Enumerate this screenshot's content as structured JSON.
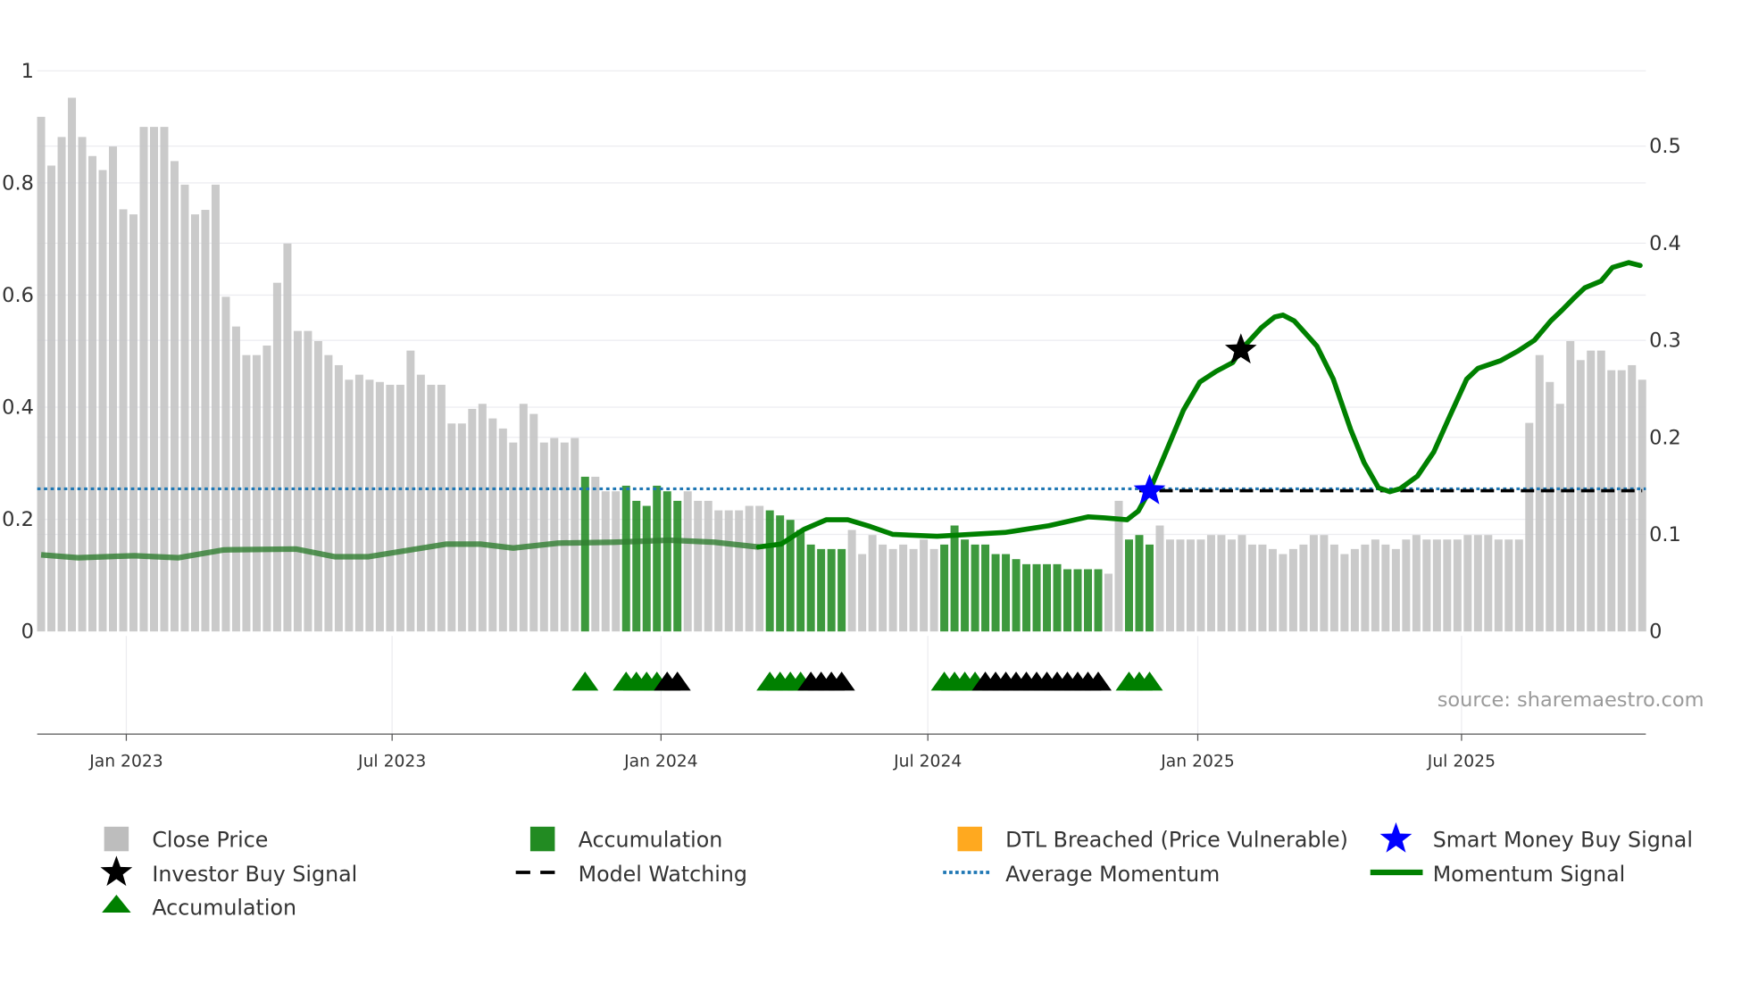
{
  "chart_data": {
    "type": "bar",
    "title": "",
    "xlabel": "",
    "ylabel_left": "",
    "ylabel_right": "",
    "frequency": "weekly",
    "left_axis": {
      "range": [
        0,
        1
      ],
      "ticks": [
        "0",
        "0.2",
        "0.4",
        "0.6",
        "0.8",
        "1"
      ],
      "tick_values": [
        0,
        0.2,
        0.4,
        0.6,
        0.8,
        1
      ]
    },
    "right_axis": {
      "range": [
        0,
        0.5
      ],
      "ticks": [
        "0",
        "0.1",
        "0.2",
        "0.3",
        "0.4",
        "0.5"
      ],
      "tick_values": [
        0,
        0.1,
        0.2,
        0.3,
        0.4,
        0.5
      ]
    },
    "x_ticks": [
      {
        "label": "Jan 2023",
        "week_index": 8.3
      },
      {
        "label": "Jul 2023",
        "week_index": 34.2
      },
      {
        "label": "Jan 2024",
        "week_index": 60.4
      },
      {
        "label": "Jul 2024",
        "week_index": 86.4
      },
      {
        "label": "Jan 2025",
        "week_index": 112.7
      },
      {
        "label": "Jul 2025",
        "week_index": 138.4
      }
    ],
    "close_price": [
      0.918,
      0.831,
      0.882,
      0.952,
      0.882,
      0.848,
      0.823,
      0.865,
      0.753,
      0.744,
      0.9,
      0.9,
      0.9,
      0.839,
      0.797,
      0.744,
      0.752,
      0.797,
      0.597,
      0.544,
      0.493,
      0.493,
      0.51,
      0.622,
      0.692,
      0.536,
      0.536,
      0.518,
      0.493,
      0.475,
      0.449,
      0.458,
      0.449,
      0.445,
      0.44,
      0.44,
      0.501,
      0.458,
      0.44,
      0.44,
      0.371,
      0.371,
      0.397,
      0.406,
      0.38,
      0.362,
      0.337,
      0.406,
      0.388,
      0.337,
      0.345,
      0.337,
      0.345,
      0.276,
      0.276,
      0.25,
      0.25,
      0.26,
      0.233,
      0.224,
      0.26,
      0.25,
      0.233,
      0.25,
      0.233,
      0.233,
      0.216,
      0.216,
      0.216,
      0.224,
      0.224,
      0.216,
      0.207,
      0.199,
      0.181,
      0.155,
      0.147,
      0.147,
      0.147,
      0.181,
      0.138,
      0.172,
      0.155,
      0.147,
      0.155,
      0.147,
      0.164,
      0.147,
      0.155,
      0.189,
      0.164,
      0.155,
      0.155,
      0.138,
      0.138,
      0.129,
      0.12,
      0.12,
      0.12,
      0.12,
      0.111,
      0.111,
      0.111,
      0.111,
      0.103,
      0.233,
      0.164,
      0.172,
      0.155,
      0.189,
      0.164,
      0.164,
      0.164,
      0.164,
      0.172,
      0.172,
      0.164,
      0.172,
      0.155,
      0.155,
      0.147,
      0.138,
      0.147,
      0.155,
      0.172,
      0.172,
      0.155,
      0.138,
      0.147,
      0.155,
      0.164,
      0.155,
      0.147,
      0.164,
      0.172,
      0.164,
      0.164,
      0.164,
      0.164,
      0.172,
      0.172,
      0.172,
      0.164,
      0.164,
      0.164,
      0.372,
      0.493,
      0.445,
      0.406,
      0.518,
      0.484,
      0.501,
      0.501,
      0.466,
      0.466,
      0.475,
      0.449
    ],
    "accumulation_bar_indices": [
      53,
      57,
      58,
      59,
      60,
      61,
      62,
      71,
      72,
      73,
      74,
      75,
      76,
      77,
      78,
      88,
      89,
      90,
      91,
      92,
      93,
      94,
      95,
      96,
      97,
      98,
      99,
      100,
      101,
      102,
      103,
      106,
      107,
      108
    ],
    "momentum_signal": [
      [
        0,
        0.079
      ],
      [
        3.6,
        0.076
      ],
      [
        9.1,
        0.078
      ],
      [
        13.4,
        0.076
      ],
      [
        17.8,
        0.084
      ],
      [
        24.8,
        0.085
      ],
      [
        28.6,
        0.077
      ],
      [
        31.9,
        0.077
      ],
      [
        39.5,
        0.09
      ],
      [
        42.8,
        0.09
      ],
      [
        46,
        0.086
      ],
      [
        50.4,
        0.091
      ],
      [
        55.8,
        0.092
      ],
      [
        61.2,
        0.094
      ],
      [
        65.6,
        0.092
      ],
      [
        69.9,
        0.087
      ],
      [
        72.1,
        0.09
      ],
      [
        74.3,
        0.105
      ],
      [
        76.5,
        0.115
      ],
      [
        78.6,
        0.115
      ],
      [
        80.8,
        0.108
      ],
      [
        83,
        0.1
      ],
      [
        87.3,
        0.098
      ],
      [
        93.9,
        0.102
      ],
      [
        98.2,
        0.109
      ],
      [
        102,
        0.118
      ],
      [
        103.6,
        0.117
      ],
      [
        105.8,
        0.115
      ],
      [
        106.9,
        0.124
      ],
      [
        108,
        0.145
      ],
      [
        109.6,
        0.185
      ],
      [
        111.3,
        0.228
      ],
      [
        112.9,
        0.257
      ],
      [
        114.5,
        0.268
      ],
      [
        116.1,
        0.277
      ],
      [
        116.9,
        0.29
      ],
      [
        118.9,
        0.313
      ],
      [
        120.2,
        0.324
      ],
      [
        121,
        0.326
      ],
      [
        122.1,
        0.32
      ],
      [
        124.3,
        0.294
      ],
      [
        125.9,
        0.26
      ],
      [
        127.6,
        0.208
      ],
      [
        128.9,
        0.174
      ],
      [
        130.3,
        0.148
      ],
      [
        131.4,
        0.144
      ],
      [
        132.4,
        0.147
      ],
      [
        134.1,
        0.16
      ],
      [
        135.7,
        0.185
      ],
      [
        137.3,
        0.223
      ],
      [
        138.9,
        0.26
      ],
      [
        140,
        0.271
      ],
      [
        142.2,
        0.279
      ],
      [
        143.9,
        0.289
      ],
      [
        145.5,
        0.3
      ],
      [
        147.1,
        0.32
      ],
      [
        148.2,
        0.331
      ],
      [
        149.3,
        0.343
      ],
      [
        150.4,
        0.354
      ],
      [
        152,
        0.361
      ],
      [
        153.1,
        0.375
      ],
      [
        154.7,
        0.38
      ],
      [
        155.8,
        0.377
      ]
    ],
    "momentum_muted_until_index": 72,
    "average_momentum": 0.147,
    "model_watching": {
      "value": 0.145,
      "from_index": 107,
      "to_index": 156
    },
    "smart_money_buy_signal": {
      "index": 108,
      "value": 0.145
    },
    "investor_buy_signal": {
      "index": 116.9,
      "value": 0.29
    },
    "accumulation_markers": [
      {
        "index": 53,
        "type": "green"
      },
      {
        "index": 57,
        "type": "green"
      },
      {
        "index": 58,
        "type": "green"
      },
      {
        "index": 59,
        "type": "green"
      },
      {
        "index": 60,
        "type": "green"
      },
      {
        "index": 61,
        "type": "black"
      },
      {
        "index": 62,
        "type": "black"
      },
      {
        "index": 71,
        "type": "green"
      },
      {
        "index": 72,
        "type": "green"
      },
      {
        "index": 73,
        "type": "green"
      },
      {
        "index": 74,
        "type": "green"
      },
      {
        "index": 75,
        "type": "black"
      },
      {
        "index": 76,
        "type": "black"
      },
      {
        "index": 77,
        "type": "black"
      },
      {
        "index": 78,
        "type": "black"
      },
      {
        "index": 88,
        "type": "green"
      },
      {
        "index": 89,
        "type": "green"
      },
      {
        "index": 90,
        "type": "green"
      },
      {
        "index": 91,
        "type": "green"
      },
      {
        "index": 92,
        "type": "black"
      },
      {
        "index": 93,
        "type": "black"
      },
      {
        "index": 94,
        "type": "black"
      },
      {
        "index": 95,
        "type": "black"
      },
      {
        "index": 96,
        "type": "black"
      },
      {
        "index": 97,
        "type": "black"
      },
      {
        "index": 98,
        "type": "black"
      },
      {
        "index": 99,
        "type": "black"
      },
      {
        "index": 100,
        "type": "black"
      },
      {
        "index": 101,
        "type": "black"
      },
      {
        "index": 102,
        "type": "black"
      },
      {
        "index": 103,
        "type": "black"
      },
      {
        "index": 106,
        "type": "green"
      },
      {
        "index": 107,
        "type": "green"
      },
      {
        "index": 108,
        "type": "green"
      }
    ],
    "legend": {
      "placement": "bottom",
      "close_price": "Close Price",
      "accumulation_bar": "Accumulation",
      "dtl_breached": "DTL Breached (Price Vulnerable)",
      "smart_money": "Smart Money Buy Signal",
      "investor_buy": "Investor Buy Signal",
      "model_watching": "Model Watching",
      "average_momentum": "Average Momentum",
      "momentum_signal": "Momentum Signal",
      "accumulation_marker": "Accumulation"
    },
    "annotation": "source: sharemaestro.com",
    "colors": {
      "close_price": "#c4c4c4",
      "accumulation": "#228b22",
      "dtl": "#ffa91f",
      "momentum": "#008000",
      "average": "#1f77b4",
      "smart_money": "#0000ff",
      "investor": "#000000"
    }
  }
}
